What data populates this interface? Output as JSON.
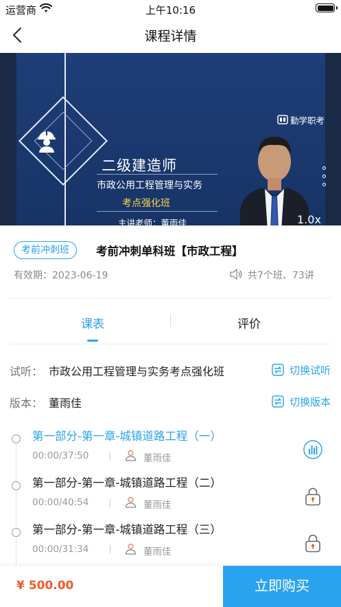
{
  "status_bar": {
    "carrier": "运营商",
    "time": "上午10:16"
  },
  "nav": {
    "title": "课程详情"
  },
  "video": {
    "title": "二级建造师",
    "subtitle": "市政公用工程管理与实务",
    "highlight": "考点强化班",
    "teacher": "主讲老师：董雨佳",
    "brand": "勤学职考",
    "speed": "1.0x"
  },
  "course": {
    "tag": "考前冲刺班",
    "title": "考前冲刺单科班【市政工程】",
    "validity": "有效期：2023-06-19",
    "count": "共7个班、73讲"
  },
  "tabs": [
    {
      "label": "课表"
    },
    {
      "label": "评价"
    }
  ],
  "trial": {
    "label": "试听：",
    "value": "市政公用工程管理与实务考点强化班",
    "switch_label": "切换试听"
  },
  "version": {
    "label": "版本：",
    "value": "董雨佳",
    "switch_label": "切换版本"
  },
  "lessons": [
    {
      "title": "第一部分-第一章-城镇道路工程（一）",
      "duration": "00:00/37:50",
      "teacher": "董雨佳",
      "state": "playing",
      "icon": "audio-bars-icon"
    },
    {
      "title": "第一部分-第一章-城镇道路工程（二）",
      "duration": "00:00/40:54",
      "teacher": "董雨佳",
      "state": "locked",
      "icon": "lock-icon"
    },
    {
      "title": "第一部分-第一章-城镇道路工程（三）",
      "duration": "00:00/31:34",
      "teacher": "董雨佳",
      "state": "locked",
      "icon": "lock-icon"
    }
  ],
  "purchase": {
    "price": "¥ 500.00",
    "buy_label": "立即购买"
  },
  "colors": {
    "accent": "#2aa3ee",
    "price": "#f05a2a",
    "video_bg": "#1f3e78",
    "lock": "#f05a2a"
  }
}
